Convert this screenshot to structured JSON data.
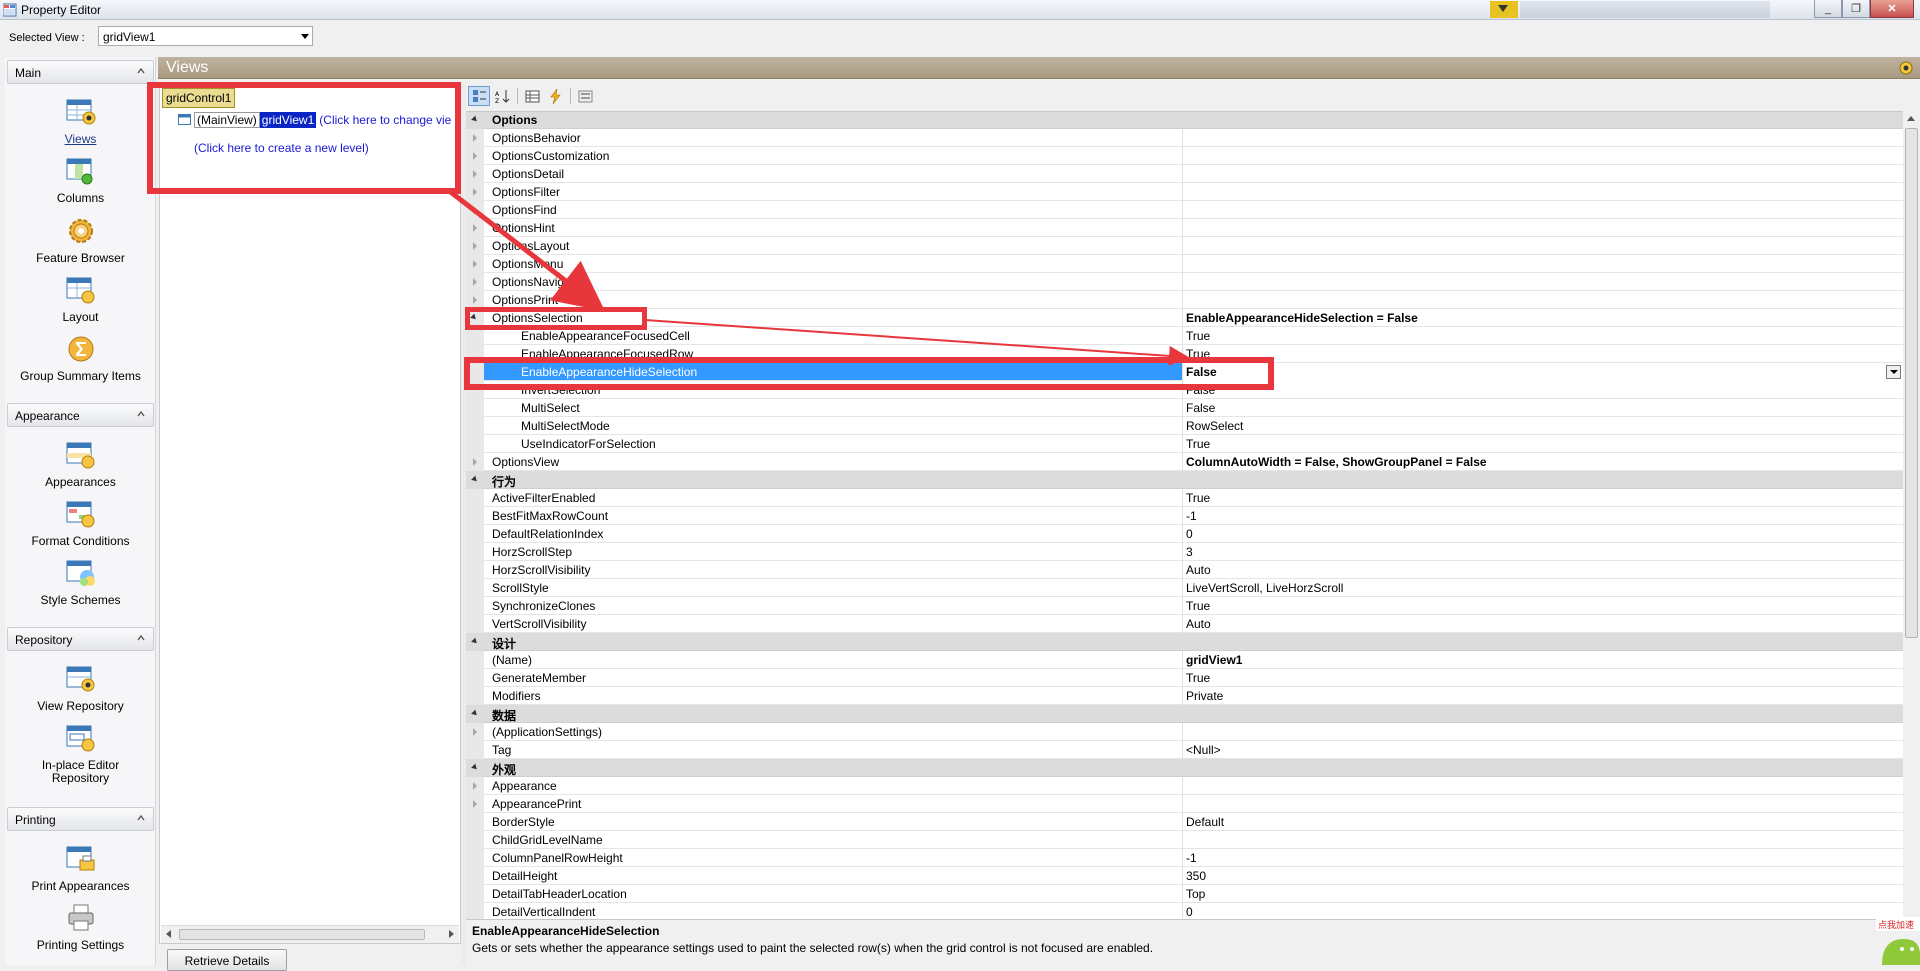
{
  "window": {
    "title": "Property Editor",
    "minimize": "_",
    "restore": "❐",
    "close": "✕"
  },
  "selected_view": {
    "label": "Selected View :",
    "value": "gridView1"
  },
  "nav": {
    "groups": [
      {
        "label": "Main"
      },
      {
        "label": "Appearance"
      },
      {
        "label": "Repository"
      },
      {
        "label": "Printing"
      }
    ],
    "main_items": [
      "Views",
      "Columns",
      "Feature Browser",
      "Layout",
      "Group Summary Items"
    ],
    "appearance_items": [
      "Appearances",
      "Format Conditions",
      "Style Schemes"
    ],
    "repository_items": [
      "View Repository",
      "In-place Editor Repository"
    ],
    "printing_items": [
      "Print Appearances",
      "Printing Settings"
    ]
  },
  "views_panel": {
    "title": "Views",
    "tree_root": "gridControl1",
    "main_view": "(MainView)",
    "grid_view": "gridView1",
    "change_hint": "(Click here to change vie",
    "new_level": "(Click here to create a new level)",
    "retrieve_button": "Retrieve Details"
  },
  "property_grid": {
    "rows": [
      {
        "type": "cat",
        "name": "Options"
      },
      {
        "type": "prop",
        "name": "OptionsBehavior",
        "value": "",
        "level": 0,
        "expander": "collapsed"
      },
      {
        "type": "prop",
        "name": "OptionsCustomization",
        "value": "",
        "level": 0,
        "expander": "collapsed"
      },
      {
        "type": "prop",
        "name": "OptionsDetail",
        "value": "",
        "level": 0,
        "expander": "collapsed"
      },
      {
        "type": "prop",
        "name": "OptionsFilter",
        "value": "",
        "level": 0,
        "expander": "collapsed"
      },
      {
        "type": "prop",
        "name": "OptionsFind",
        "value": "",
        "level": 0,
        "expander": "collapsed"
      },
      {
        "type": "prop",
        "name": "OptionsHint",
        "value": "",
        "level": 0,
        "expander": "collapsed"
      },
      {
        "type": "prop",
        "name": "OptionsLayout",
        "value": "",
        "level": 0,
        "expander": "collapsed"
      },
      {
        "type": "prop",
        "name": "OptionsMenu",
        "value": "",
        "level": 0,
        "expander": "collapsed"
      },
      {
        "type": "prop",
        "name": "OptionsNavigation",
        "value": "",
        "level": 0,
        "expander": "collapsed"
      },
      {
        "type": "prop",
        "name": "OptionsPrint",
        "value": "",
        "level": 0,
        "expander": "collapsed"
      },
      {
        "type": "prop",
        "name": "OptionsSelection",
        "value": "EnableAppearanceHideSelection = False",
        "level": 0,
        "expander": "expanded",
        "bold_value": true
      },
      {
        "type": "prop",
        "name": "EnableAppearanceFocusedCell",
        "value": "True",
        "level": 1
      },
      {
        "type": "prop",
        "name": "EnableAppearanceFocusedRow",
        "value": "True",
        "level": 1
      },
      {
        "type": "prop",
        "name": "EnableAppearanceHideSelection",
        "value": "False",
        "level": 1,
        "selected": true
      },
      {
        "type": "prop",
        "name": "InvertSelection",
        "value": "False",
        "level": 1
      },
      {
        "type": "prop",
        "name": "MultiSelect",
        "value": "False",
        "level": 1
      },
      {
        "type": "prop",
        "name": "MultiSelectMode",
        "value": "RowSelect",
        "level": 1
      },
      {
        "type": "prop",
        "name": "UseIndicatorForSelection",
        "value": "True",
        "level": 1
      },
      {
        "type": "prop",
        "name": "OptionsView",
        "value": "ColumnAutoWidth = False, ShowGroupPanel = False",
        "level": 0,
        "expander": "collapsed",
        "bold_value": true
      },
      {
        "type": "cat",
        "name": "行为"
      },
      {
        "type": "prop",
        "name": "ActiveFilterEnabled",
        "value": "True",
        "level": 0
      },
      {
        "type": "prop",
        "name": "BestFitMaxRowCount",
        "value": "-1",
        "level": 0
      },
      {
        "type": "prop",
        "name": "DefaultRelationIndex",
        "value": "0",
        "level": 0
      },
      {
        "type": "prop",
        "name": "HorzScrollStep",
        "value": "3",
        "level": 0
      },
      {
        "type": "prop",
        "name": "HorzScrollVisibility",
        "value": "Auto",
        "level": 0
      },
      {
        "type": "prop",
        "name": "ScrollStyle",
        "value": "LiveVertScroll, LiveHorzScroll",
        "level": 0
      },
      {
        "type": "prop",
        "name": "SynchronizeClones",
        "value": "True",
        "level": 0
      },
      {
        "type": "prop",
        "name": "VertScrollVisibility",
        "value": "Auto",
        "level": 0
      },
      {
        "type": "cat",
        "name": "设计"
      },
      {
        "type": "prop",
        "name": "(Name)",
        "value": "gridView1",
        "level": 0,
        "bold_value": true
      },
      {
        "type": "prop",
        "name": "GenerateMember",
        "value": "True",
        "level": 0
      },
      {
        "type": "prop",
        "name": "Modifiers",
        "value": "Private",
        "level": 0
      },
      {
        "type": "cat",
        "name": "数据"
      },
      {
        "type": "prop",
        "name": "(ApplicationSettings)",
        "value": "",
        "level": 0,
        "expander": "collapsed"
      },
      {
        "type": "prop",
        "name": "Tag",
        "value": "<Null>",
        "level": 0
      },
      {
        "type": "cat",
        "name": "外观"
      },
      {
        "type": "prop",
        "name": "Appearance",
        "value": "",
        "level": 0,
        "expander": "collapsed"
      },
      {
        "type": "prop",
        "name": "AppearancePrint",
        "value": "",
        "level": 0,
        "expander": "collapsed"
      },
      {
        "type": "prop",
        "name": "BorderStyle",
        "value": "Default",
        "level": 0
      },
      {
        "type": "prop",
        "name": "ChildGridLevelName",
        "value": "",
        "level": 0
      },
      {
        "type": "prop",
        "name": "ColumnPanelRowHeight",
        "value": "-1",
        "level": 0
      },
      {
        "type": "prop",
        "name": "DetailHeight",
        "value": "350",
        "level": 0
      },
      {
        "type": "prop",
        "name": "DetailTabHeaderLocation",
        "value": "Top",
        "level": 0
      },
      {
        "type": "prop",
        "name": "DetailVerticalIndent",
        "value": "0",
        "level": 0
      }
    ]
  },
  "description": {
    "title": "EnableAppearanceHideSelection",
    "text": "Gets or sets whether the appearance settings used to paint the selected row(s) when the grid control is not focused are enabled."
  },
  "badge": {
    "label": "点我加速"
  },
  "colors": {
    "annotation": "#e8373c",
    "selection": "#3399ff",
    "views_header": "#b0a38c"
  }
}
